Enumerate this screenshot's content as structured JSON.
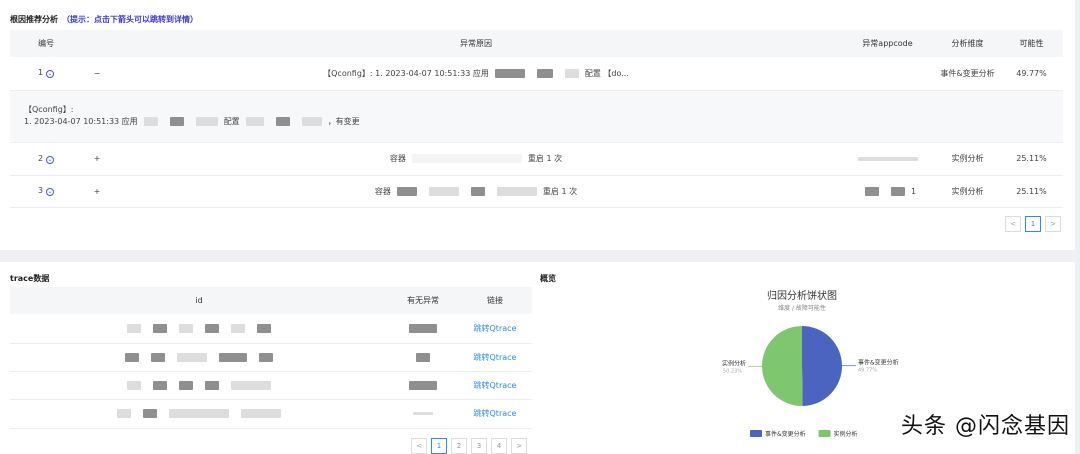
{
  "root_cause": {
    "title": "根因推荐分析",
    "hint": "（提示：点击下箭头可以跳转到详情）",
    "columns": [
      "编号",
      "异常原因",
      "异常appcode",
      "分析维度",
      "可能性"
    ],
    "rows": [
      {
        "no": "1",
        "toggle": "−",
        "reason_prefix": "【Qconfig】: 1. 2023-04-07 10:51:33 应用",
        "reason_mid": "配置",
        "reason_suffix": "【do...",
        "appcode": "",
        "dimension": "事件&变更分析",
        "probability": "49.77%",
        "detail_line1": "【Qconfig】:",
        "detail_line2_prefix": "1. 2023-04-07 10:51:33 应用",
        "detail_mid": "配置",
        "detail_suffix": "，有变更"
      },
      {
        "no": "2",
        "toggle": "+",
        "reason_prefix": "容器",
        "reason_suffix": "重启 1 次",
        "appcode": "",
        "dimension": "实例分析",
        "probability": "25.11%"
      },
      {
        "no": "3",
        "toggle": "+",
        "reason_prefix": "容器",
        "reason_suffix": "重启 1 次",
        "appcode": "1",
        "dimension": "实例分析",
        "probability": "25.11%"
      }
    ],
    "pagination": {
      "prev": "<",
      "current": "1",
      "next": ">"
    }
  },
  "trace": {
    "title": "trace数据",
    "columns": [
      "id",
      "有无异常",
      "链接"
    ],
    "rows": [
      {
        "link": "跳转Qtrace"
      },
      {
        "link": "跳转Qtrace"
      },
      {
        "link": "跳转Qtrace"
      },
      {
        "link": "跳转Qtrace"
      }
    ],
    "pagination": {
      "prev": "<",
      "pages": [
        "1",
        "2",
        "3",
        "4"
      ],
      "next": ">"
    }
  },
  "overview": {
    "title": "概览"
  },
  "chart_data": {
    "type": "pie",
    "title": "归因分析饼状图",
    "subtitle": "维度 / 故障可能性",
    "slices": [
      {
        "name": "事件&变更分析",
        "value": 49.77,
        "label": "49.77%",
        "color": "#4a64c0"
      },
      {
        "name": "实例分析",
        "value": 50.23,
        "label": "50.23%",
        "color": "#7fc76e"
      }
    ],
    "legend": "bottom-center"
  },
  "watermark": "头条 @闪念基因"
}
